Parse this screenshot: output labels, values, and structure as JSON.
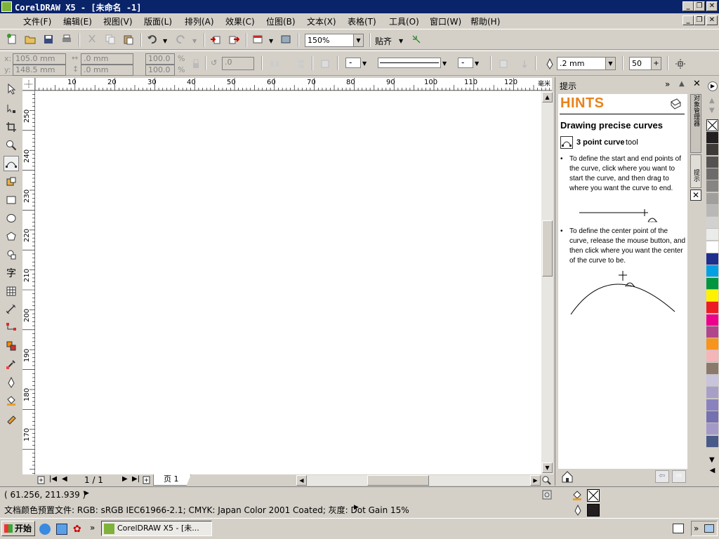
{
  "window": {
    "title": "CorelDRAW X5 - [未命名 -1]",
    "min_glyph": "_",
    "max_glyph": "❐",
    "close_glyph": "✕"
  },
  "menu": [
    "文件(F)",
    "编辑(E)",
    "视图(V)",
    "版面(L)",
    "排列(A)",
    "效果(C)",
    "位图(B)",
    "文本(X)",
    "表格(T)",
    "工具(O)",
    "窗口(W)",
    "帮助(H)"
  ],
  "standard_toolbar": {
    "zoom_value": "150%",
    "snap_label": "贴齐"
  },
  "property_bar": {
    "x_label": "x:",
    "x_value": "105.0 mm",
    "y_label": "y:",
    "y_value": "148.5 mm",
    "w_value": ".0 mm",
    "h_value": ".0 mm",
    "scale_x": "100.0",
    "scale_y": "100.0",
    "percent_x": "%",
    "percent_y": "%",
    "rotate_value": ".0",
    "outline_width": ".2 mm",
    "smoothing_value": "50"
  },
  "rulers": {
    "h_ticks": [
      "10",
      "20",
      "30",
      "40",
      "50",
      "60",
      "70",
      "80",
      "90",
      "100",
      "110",
      "120"
    ],
    "h_unit": "毫米",
    "v_ticks": [
      "250",
      "240",
      "230",
      "220",
      "210",
      "200",
      "190",
      "180",
      "170"
    ]
  },
  "page_nav": {
    "page_count": "1 / 1",
    "page_tab": "页 1"
  },
  "docker": {
    "header_title": "提示",
    "hints_title": "HINTS",
    "heading": "Drawing precise curves",
    "tool_name": "3 point curve",
    "tool_suffix": " tool",
    "bullet_1": "To define the start and end points of the curve, click where you want to start the curve, and then drag to where you want the curve to end.",
    "bullet_2": "To define the center point of the curve, release the mouse button, and then click where you want the center of the curve to be.",
    "side_tab_1": "对象管理器",
    "side_tab_2": "提示"
  },
  "palette": [
    "#231f20",
    "#3d3a38",
    "#555351",
    "#6e6c6a",
    "#878583",
    "#a09f9d",
    "#b9b8b6",
    "#d2d1cf",
    "#ebebea",
    "#ffffff",
    "#1d2e8c",
    "#00a0e2",
    "#00963f",
    "#fff200",
    "#ed1c24",
    "#ec008c",
    "#b0478c",
    "#f7941d",
    "#f4b6b8",
    "#8b7a6c",
    "#c8c4dc",
    "#a89fc8",
    "#8a82be",
    "#7570b0",
    "#a49ac8",
    "#4a5a88"
  ],
  "status": {
    "coords": "( 61.256, 211.939 )",
    "color_profile": "文档颜色预置文件: RGB: sRGB IEC61966-2.1; CMYK: Japan Color 2001 Coated; 灰度: Dot Gain 15%"
  },
  "taskbar": {
    "start_label": "开始",
    "task_label": "CorelDRAW X5 - [未...",
    "chevron": "»"
  }
}
